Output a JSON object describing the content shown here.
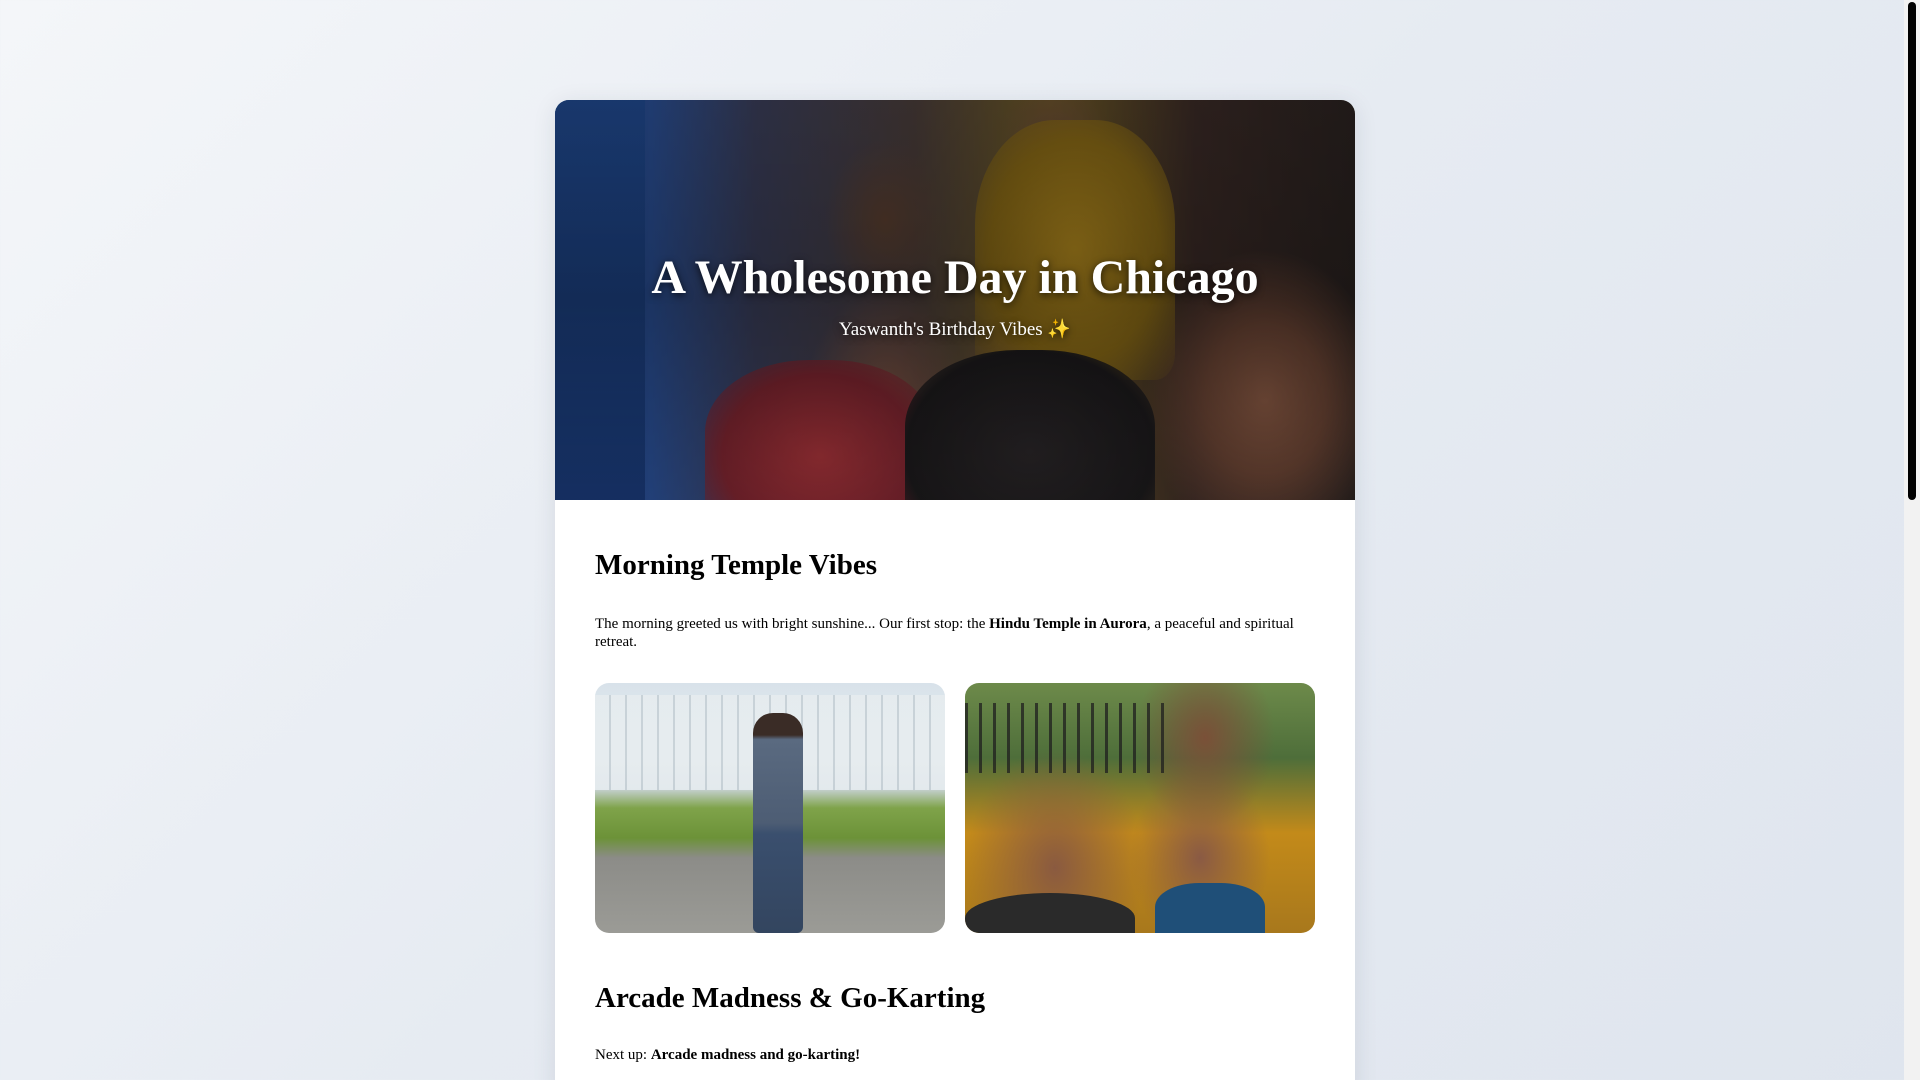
{
  "hero": {
    "title": "A Wholesome Day in Chicago",
    "subtitle": "Yaswanth's Birthday Vibes ✨"
  },
  "sections": [
    {
      "title": "Morning Temple Vibes",
      "paragraph_before": "The morning greeted us with bright sunshine... Our first stop: the ",
      "paragraph_bold": "Hindu Temple in Aurora",
      "paragraph_after": ", a peaceful and spiritual retreat.",
      "photos": [
        "temple-front-photo",
        "friends-selfie-photo"
      ]
    },
    {
      "title": "Arcade Madness & Go-Karting",
      "paragraph_before": "Next up: ",
      "paragraph_bold": "Arcade madness and go-karting!",
      "paragraph_after": ""
    }
  ]
}
